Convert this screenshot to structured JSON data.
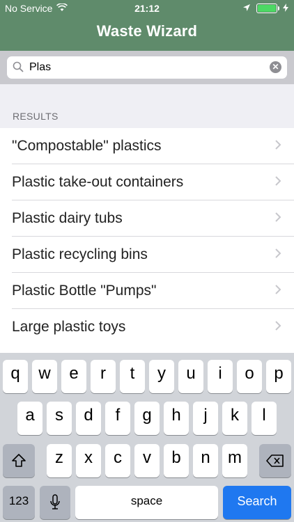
{
  "status": {
    "carrier": "No Service",
    "time": "21:12"
  },
  "header": {
    "title": "Waste Wizard"
  },
  "search": {
    "value": "Plas",
    "clear_glyph": "✕"
  },
  "section": {
    "label": "RESULTS"
  },
  "results": [
    "\"Compostable\" plastics",
    "Plastic take-out containers",
    "Plastic dairy tubs",
    "Plastic recycling bins",
    "Plastic Bottle \"Pumps\"",
    "Large plastic toys"
  ],
  "keyboard": {
    "row1": [
      "q",
      "w",
      "e",
      "r",
      "t",
      "y",
      "u",
      "i",
      "o",
      "p"
    ],
    "row2": [
      "a",
      "s",
      "d",
      "f",
      "g",
      "h",
      "j",
      "k",
      "l"
    ],
    "row3": [
      "z",
      "x",
      "c",
      "v",
      "b",
      "n",
      "m"
    ],
    "numbers_label": "123",
    "space_label": "space",
    "search_label": "Search"
  },
  "colors": {
    "header_bg": "#5f8b6b",
    "search_key": "#1f78f0",
    "battery": "#4cd964"
  }
}
